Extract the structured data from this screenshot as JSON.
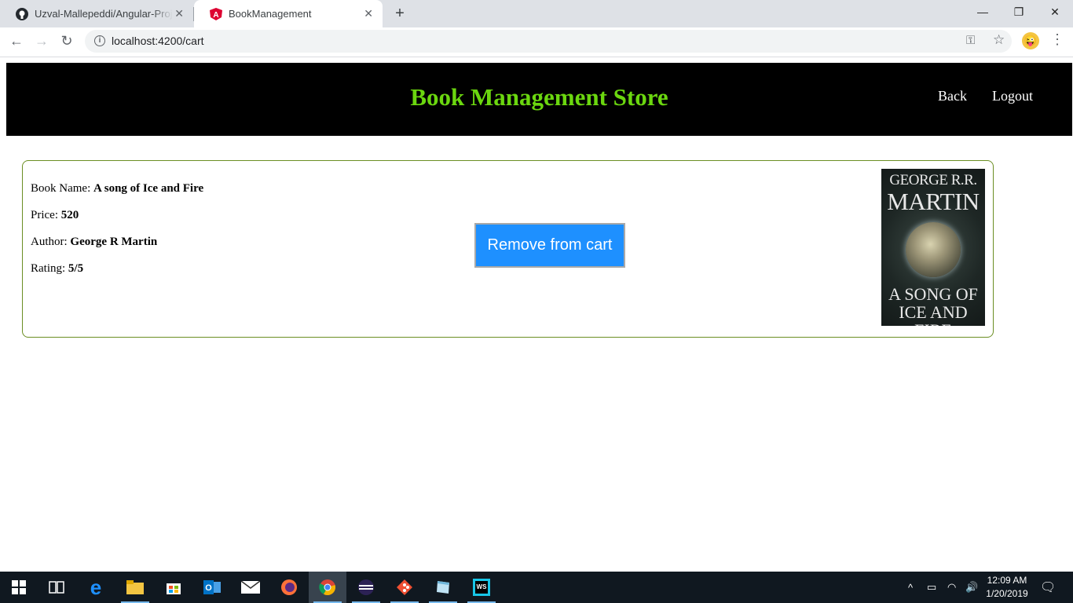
{
  "browser": {
    "tabs": [
      {
        "title": "Uzval-Mallepeddi/Angular-Project",
        "icon": "github-icon"
      },
      {
        "title": "BookManagement",
        "icon": "angular-icon"
      }
    ],
    "url": "localhost:4200/cart"
  },
  "header": {
    "title": "Book Management Store",
    "title_color": "#6bd70f",
    "links": {
      "back": "Back",
      "logout": "Logout"
    }
  },
  "cart": {
    "items": [
      {
        "name_label": "Book Name: ",
        "name": "A song of Ice and Fire",
        "price_label": "Price: ",
        "price": "520",
        "author_label": "Author: ",
        "author": "George R Martin",
        "rating_label": "Rating: ",
        "rating": "5/5",
        "remove_label": "Remove from cart",
        "cover": {
          "author_line1": "GEORGE R.R.",
          "author_line2": "MARTIN",
          "title_line1": "A SONG OF",
          "title_line2": "ICE AND FIRE"
        }
      }
    ]
  },
  "taskbar": {
    "apps": [
      "windows-start-icon",
      "task-view-icon",
      "edge-icon",
      "file-explorer-icon",
      "store-icon",
      "outlook-icon",
      "mail-icon",
      "firefox-icon",
      "chrome-icon",
      "eclipse-icon",
      "git-icon",
      "notepad-icon",
      "webstorm-icon"
    ],
    "time": "12:09 AM",
    "date": "1/20/2019"
  },
  "colors": {
    "accent_button": "#1e90ff",
    "card_border": "#6b8e23"
  }
}
